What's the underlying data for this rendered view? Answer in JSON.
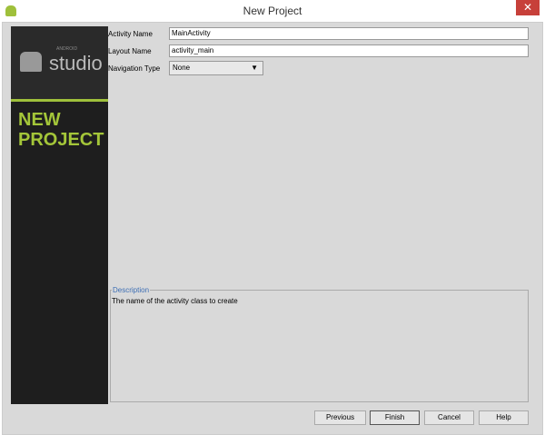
{
  "window": {
    "title": "New Project",
    "close": "✕"
  },
  "sidebar": {
    "logo_small": "ANDROID",
    "logo": "studio",
    "heading_line1": "NEW",
    "heading_line2": "PROJECT"
  },
  "form": {
    "activity_name_label": "Activity Name",
    "activity_name_value": "MainActivity",
    "layout_name_label": "Layout Name",
    "layout_name_value": "activity_main",
    "navigation_type_label": "Navigation Type",
    "navigation_type_value": "None"
  },
  "description": {
    "legend": "Description",
    "text": "The name of the activity class to create"
  },
  "buttons": {
    "previous": "Previous",
    "finish": "Finish",
    "cancel": "Cancel",
    "help": "Help"
  }
}
